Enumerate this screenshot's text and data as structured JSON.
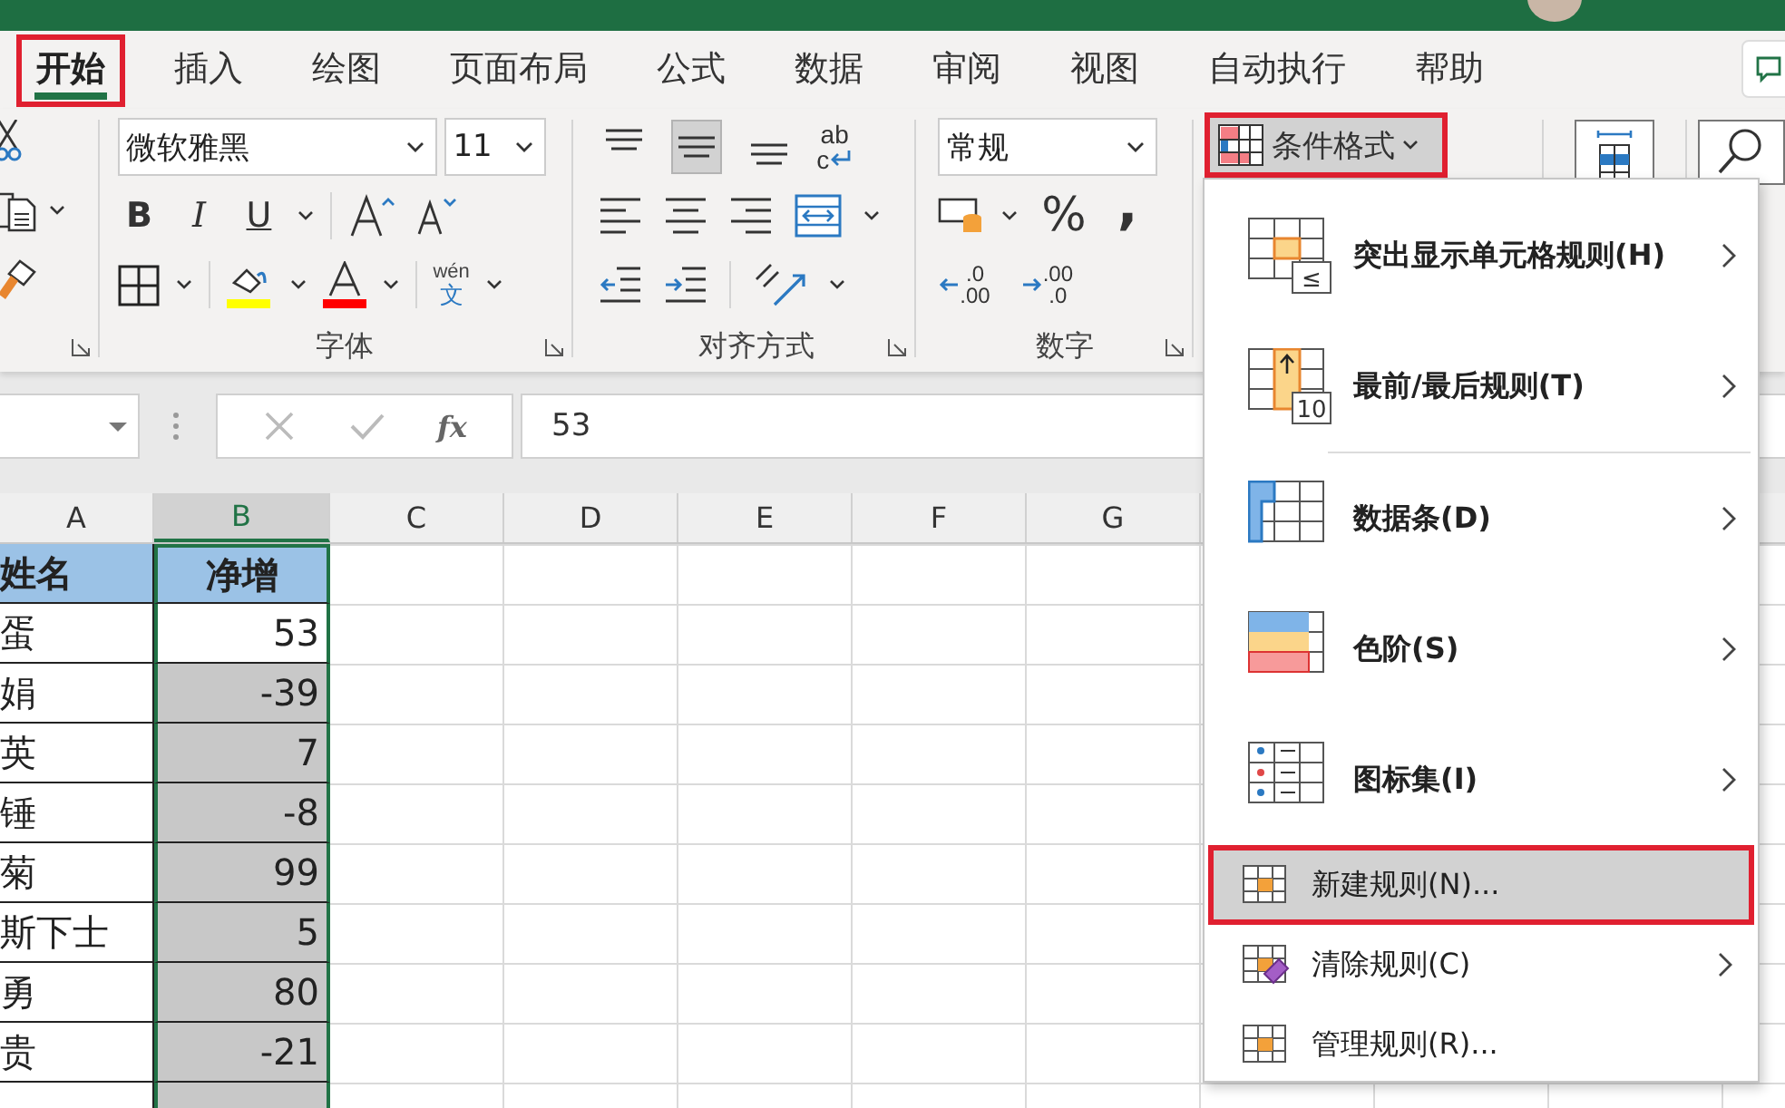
{
  "tabs": [
    {
      "label": "开始",
      "selected": true,
      "highlighted": true
    },
    {
      "label": "插入",
      "selected": false,
      "highlighted": false
    },
    {
      "label": "绘图",
      "selected": false,
      "highlighted": false
    },
    {
      "label": "页面布局",
      "selected": false,
      "highlighted": false
    },
    {
      "label": "公式",
      "selected": false,
      "highlighted": false
    },
    {
      "label": "数据",
      "selected": false,
      "highlighted": false
    },
    {
      "label": "审阅",
      "selected": false,
      "highlighted": false
    },
    {
      "label": "视图",
      "selected": false,
      "highlighted": false
    },
    {
      "label": "自动执行",
      "selected": false,
      "highlighted": false
    },
    {
      "label": "帮助",
      "selected": false,
      "highlighted": false
    }
  ],
  "ribbon": {
    "font": {
      "font_name": "微软雅黑",
      "font_size": "11",
      "style_buttons": [
        "B",
        "I",
        "U"
      ],
      "phonetic": {
        "top": "wén",
        "bottom": "文"
      },
      "label": "字体"
    },
    "alignment": {
      "vertical_align": [
        {
          "selected": false
        },
        {
          "selected": true
        },
        {
          "selected": false
        }
      ],
      "wrap": {
        "top": "ab",
        "bottom": "c"
      },
      "label": "对齐方式"
    },
    "number": {
      "format": "常规",
      "symbols": [
        "%",
        ","
      ],
      "decimals": [
        {
          "top": ".0",
          "bottom": ".00"
        },
        {
          "top": ".00",
          "bottom": ".0"
        }
      ],
      "label": "数字"
    },
    "styles": {
      "conditional_format": {
        "label": "条件格式",
        "highlighted": true
      }
    }
  },
  "formula_bar": {
    "fx": "fx",
    "value": "53"
  },
  "sheet": {
    "columns": [
      {
        "label": "A",
        "selected": false
      },
      {
        "label": "B",
        "selected": true
      },
      {
        "label": "C",
        "selected": false
      },
      {
        "label": "D",
        "selected": false
      },
      {
        "label": "E",
        "selected": false
      },
      {
        "label": "F",
        "selected": false
      },
      {
        "label": "G",
        "selected": false
      }
    ],
    "header": {
      "name": "姓名",
      "value": "净增"
    },
    "rows": [
      {
        "name": "蛋",
        "value": "53",
        "selected": true,
        "active": true
      },
      {
        "name": "娟",
        "value": "-39",
        "selected": true,
        "active": false
      },
      {
        "name": "英",
        "value": "7",
        "selected": true,
        "active": false
      },
      {
        "name": "锤",
        "value": "-8",
        "selected": true,
        "active": false
      },
      {
        "name": "菊",
        "value": "99",
        "selected": true,
        "active": false
      },
      {
        "name": "斯下士",
        "value": "5",
        "selected": true,
        "active": false
      },
      {
        "name": "勇",
        "value": "80",
        "selected": true,
        "active": false
      },
      {
        "name": "贵",
        "value": "-21",
        "selected": true,
        "active": false
      }
    ]
  },
  "menu": {
    "items": [
      {
        "kind": "large",
        "label": "突出显示单元格规则(H)",
        "icon_text": "≤",
        "submenu": true,
        "highlighted": false,
        "separator_after": false
      },
      {
        "kind": "large",
        "label": "最前/最后规则(T)",
        "icon_text": "10",
        "submenu": true,
        "highlighted": false,
        "separator_after": true
      },
      {
        "kind": "large",
        "label": "数据条(D)",
        "submenu": true,
        "highlighted": false,
        "separator_after": false
      },
      {
        "kind": "large",
        "label": "色阶(S)",
        "submenu": true,
        "highlighted": false,
        "separator_after": false
      },
      {
        "kind": "large",
        "label": "图标集(I)",
        "submenu": true,
        "highlighted": false,
        "separator_after": false
      },
      {
        "kind": "small",
        "label": "新建规则(N)...",
        "submenu": false,
        "highlighted": true,
        "separator_after": false
      },
      {
        "kind": "small",
        "label": "清除规则(C)",
        "submenu": true,
        "highlighted": false,
        "separator_after": false
      },
      {
        "kind": "small",
        "label": "管理规则(R)...",
        "submenu": false,
        "highlighted": false,
        "separator_after": false
      }
    ]
  }
}
